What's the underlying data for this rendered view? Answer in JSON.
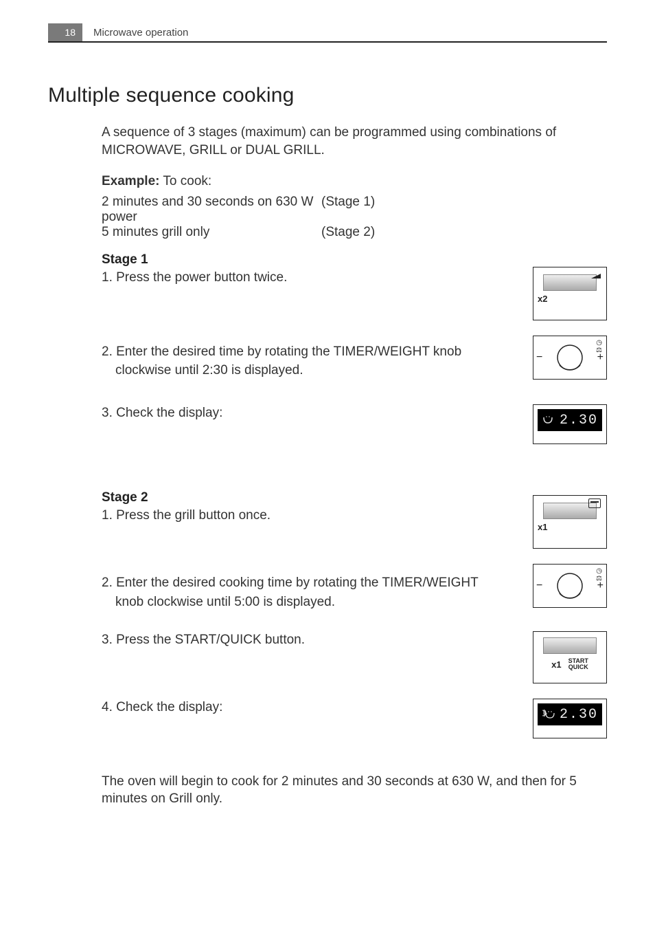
{
  "header": {
    "page_number": "18",
    "section": "Microwave operation"
  },
  "title": "Multiple sequence cooking",
  "intro": "A sequence of 3 stages (maximum) can be programmed using combinations of MICROWAVE, GRILL or DUAL GRILL.",
  "example_label": "Example:",
  "example_intro": " To cook:",
  "example_rows": [
    {
      "left": "2 minutes and 30 seconds on 630 W power",
      "right": "(Stage 1)"
    },
    {
      "left": "5 minutes grill only",
      "right": "(Stage 2)"
    }
  ],
  "stage1": {
    "heading": "Stage 1",
    "steps": {
      "s1": "1. Press the power button twice.",
      "s2": "2. Enter the desired time by rotating the TIMER/WEIGHT knob",
      "s2b": "clockwise until 2:30 is displayed.",
      "s3": "3. Check the display:"
    }
  },
  "stage2": {
    "heading": "Stage 2",
    "steps": {
      "s1": "1. Press the grill button once.",
      "s2": "2. Enter the desired cooking time by rotating the TIMER/WEIGHT",
      "s2b": "knob clockwise until 5:00 is displayed.",
      "s3": "3. Press the START/QUICK button.",
      "s4": "4. Check the display:"
    }
  },
  "footer": "The oven will begin to cook for 2 minutes and 30 seconds at 630 W, and then for 5 minutes on Grill only.",
  "illus": {
    "press_x2": "x2",
    "press_x1": "x1",
    "knob_minus": "−",
    "knob_plus": "+",
    "display1": "2.30",
    "display2": "2.30",
    "start_top": "START",
    "start_bottom": "QUICK",
    "clock_icon": "◷",
    "weight_icon": "⚖"
  }
}
